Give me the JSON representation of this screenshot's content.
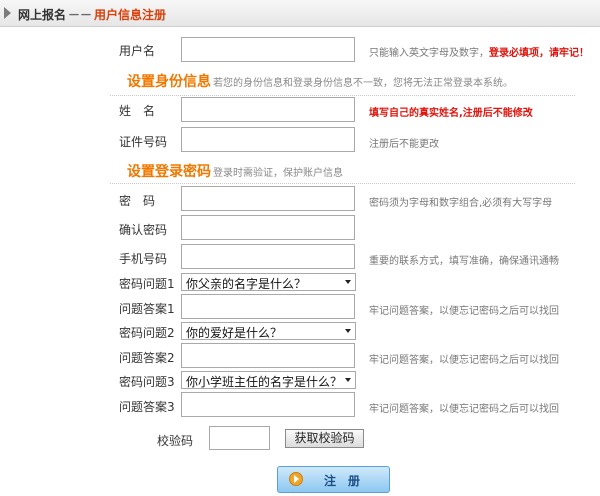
{
  "breadcrumb": {
    "root": "网上报名",
    "separator": "－－",
    "current": "用户信息注册"
  },
  "fields": {
    "username": {
      "label": "用户名",
      "tip": "只能输入英文字母及数字，",
      "tip_red": "登录必填项，请牢记！"
    },
    "name": {
      "label": "姓　名",
      "tip": "填写自己的真实姓名,注册后不能修改"
    },
    "id_number": {
      "label": "证件号码",
      "tip": "注册后不能更改"
    },
    "password": {
      "label": "密　码",
      "tip": "密码须为字母和数字组合,必须有大写字母"
    },
    "confirm_password": {
      "label": "确认密码"
    },
    "phone": {
      "label": "手机号码",
      "tip": "重要的联系方式，填写准确，确保通讯通畅"
    },
    "question1": {
      "label": "密码问题1",
      "value": "你父亲的名字是什么？"
    },
    "answer1": {
      "label": "问题答案1",
      "tip": "牢记问题答案，以便忘记密码之后可以找回"
    },
    "question2": {
      "label": "密码问题2",
      "value": "你的爱好是什么？"
    },
    "answer2": {
      "label": "问题答案2",
      "tip": "牢记问题答案，以便忘记密码之后可以找回"
    },
    "question3": {
      "label": "密码问题3",
      "value": "你小学班主任的名字是什么？"
    },
    "answer3": {
      "label": "问题答案3",
      "tip": "牢记问题答案，以便忘记密码之后可以找回"
    },
    "captcha": {
      "label": "校验码",
      "button": "获取校验码"
    }
  },
  "sections": {
    "identity": {
      "title": "设置身份信息",
      "note": "若您的身份信息和登录身份信息不一致，您将无法正常登录本系统。"
    },
    "login_password": {
      "title": "设置登录密码",
      "note": "登录时需验证，保护账户信息"
    }
  },
  "submit": {
    "label": "注　册"
  },
  "colors": {
    "section_title": "#f07800",
    "required_tip": "#e0140c",
    "breadcrumb_current": "#d9400b"
  }
}
